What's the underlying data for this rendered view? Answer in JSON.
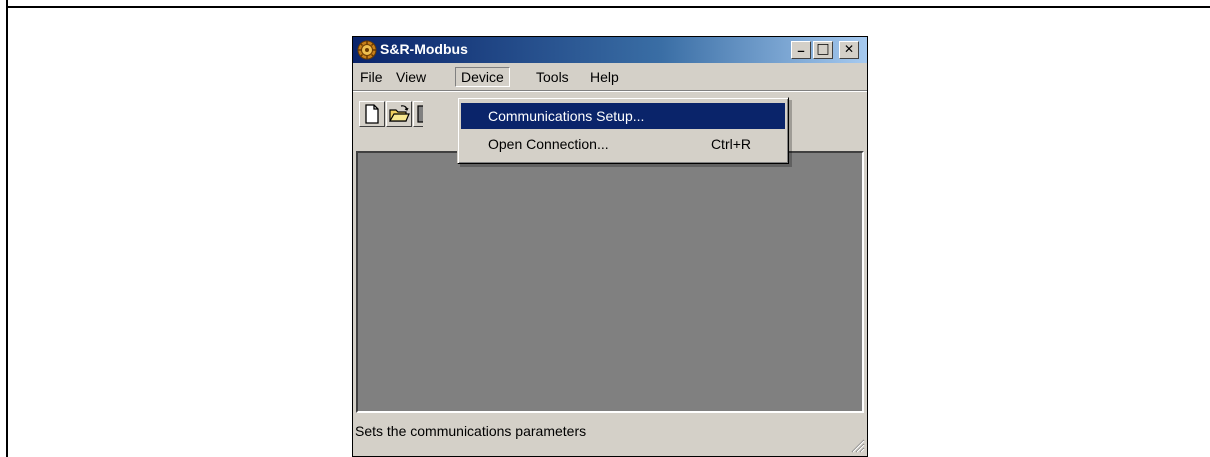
{
  "window": {
    "title": "S&R-Modbus",
    "minimize_glyph": "_",
    "maximize_glyph": "□",
    "close_glyph": "✕"
  },
  "menubar": {
    "items": [
      {
        "label": "File"
      },
      {
        "label": "View"
      },
      {
        "label": "Device"
      },
      {
        "label": "Tools"
      },
      {
        "label": "Help"
      }
    ],
    "active": "Device"
  },
  "toolbar": {
    "buttons": [
      "new-document-icon",
      "open-folder-icon",
      "save-icon"
    ]
  },
  "device_menu": {
    "items": [
      {
        "label": "Communications Setup...",
        "shortcut": "",
        "selected": true
      },
      {
        "label": "Open Connection...",
        "shortcut": "Ctrl+R",
        "selected": false
      }
    ]
  },
  "statusbar": {
    "text": "Sets the communications parameters"
  },
  "colors": {
    "titlebar_start": "#0a246a",
    "titlebar_end": "#a6caf0",
    "menu_highlight": "#0a246a",
    "client_area": "#808080",
    "chrome": "#d4d0c8"
  }
}
